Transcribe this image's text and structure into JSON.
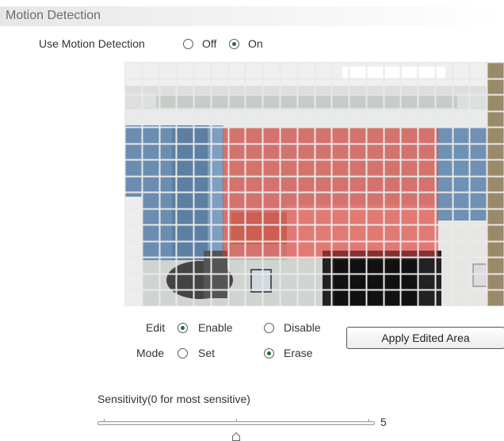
{
  "section": {
    "title": "Motion Detection"
  },
  "use_motion": {
    "label": "Use Motion Detection",
    "options": [
      {
        "label": "Off",
        "checked": false
      },
      {
        "label": "On",
        "checked": true
      }
    ]
  },
  "edit": {
    "label": "Edit",
    "options": [
      {
        "label": "Enable",
        "checked": true
      },
      {
        "label": "Disable",
        "checked": false
      }
    ]
  },
  "mode": {
    "label": "Mode",
    "options": [
      {
        "label": "Set",
        "checked": false
      },
      {
        "label": "Erase",
        "checked": true
      }
    ]
  },
  "apply_button": {
    "label": "Apply Edited Area"
  },
  "sensitivity": {
    "label": "Sensitivity(0 for most sensitive)",
    "value": "5",
    "position": 0.5
  },
  "colors": {
    "grid_line": "#e9e9e9",
    "detection_area": "#dc3c3c"
  }
}
